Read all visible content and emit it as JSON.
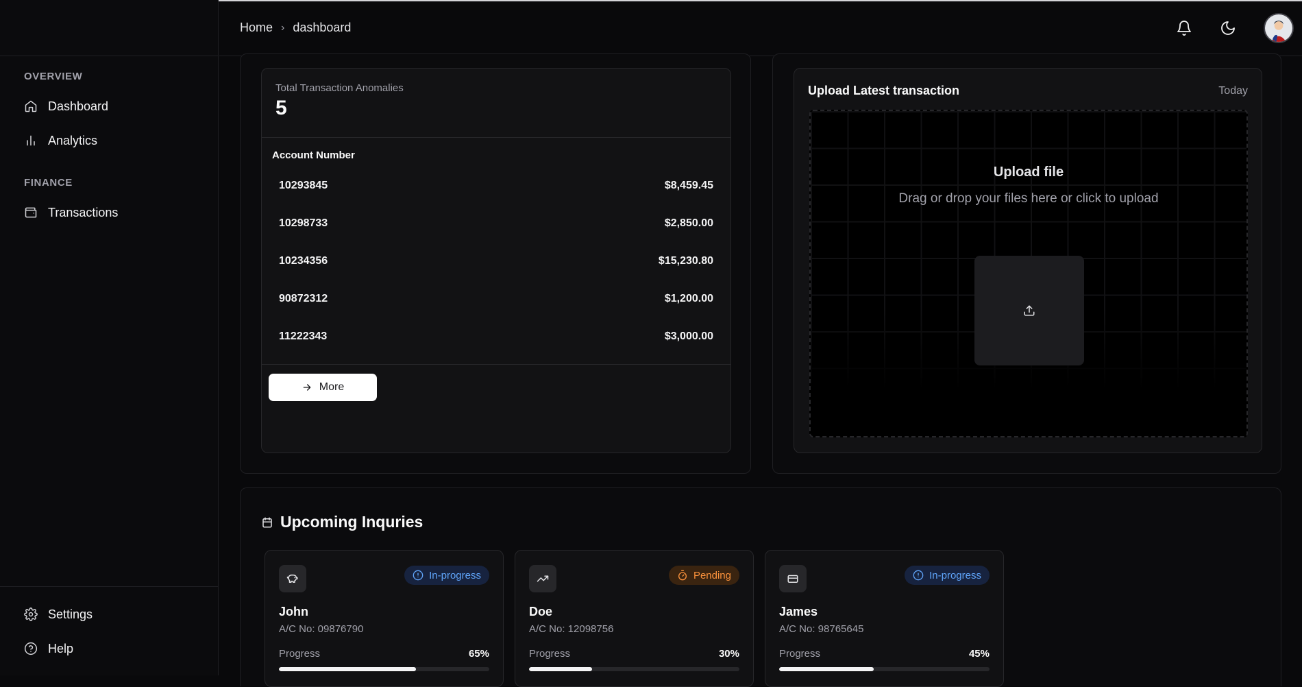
{
  "sidebar": {
    "overview_title": "OVERVIEW",
    "finance_title": "FINANCE",
    "items": [
      {
        "label": "Dashboard",
        "icon": "home-icon"
      },
      {
        "label": "Analytics",
        "icon": "bar-chart-icon"
      },
      {
        "label": "Transactions",
        "icon": "wallet-icon"
      }
    ],
    "bottom_items": [
      {
        "label": "Settings",
        "icon": "gear-icon"
      },
      {
        "label": "Help",
        "icon": "help-circle-icon"
      }
    ]
  },
  "header": {
    "breadcrumb": {
      "home": "Home",
      "current": "dashboard"
    },
    "icons": [
      "bell-icon",
      "moon-icon",
      "avatar"
    ]
  },
  "anomalies": {
    "label": "Total Transaction Anomalies",
    "value": "5",
    "table_header": "Account Number",
    "rows": [
      {
        "account": "10293845",
        "amount": "$8,459.45"
      },
      {
        "account": "10298733",
        "amount": "$2,850.00"
      },
      {
        "account": "10234356",
        "amount": "$15,230.80"
      },
      {
        "account": "90872312",
        "amount": "$1,200.00"
      },
      {
        "account": "11222343",
        "amount": "$3,000.00"
      }
    ],
    "more_label": "More"
  },
  "upload": {
    "title": "Upload Latest transaction",
    "date": "Today",
    "heading": "Upload file",
    "description": "Drag or drop your files here or click to upload"
  },
  "inquiries": {
    "title": "Upcoming Inquries",
    "cards": [
      {
        "name": "John",
        "account": "A/C No: 09876790",
        "status": "In-progress",
        "status_color": "#60a5fa",
        "icon": "piggy-bank-icon",
        "progress_label": "Progress",
        "progress_text": "65%",
        "progress": 0.65
      },
      {
        "name": "Doe",
        "account": "A/C No: 12098756",
        "status": "Pending",
        "status_color": "#fb923c",
        "icon": "trending-up-icon",
        "progress_label": "Progress",
        "progress_text": "30%",
        "progress": 0.3
      },
      {
        "name": "James",
        "account": "A/C No: 98765645",
        "status": "In-progress",
        "status_color": "#60a5fa",
        "icon": "credit-card-icon",
        "progress_label": "Progress",
        "progress_text": "45%",
        "progress": 0.45
      }
    ]
  },
  "colors": {
    "background": "#09090b",
    "card": "#121214",
    "border": "#27272a",
    "accent_blue": "#60a5fa",
    "accent_orange": "#fb923c"
  }
}
